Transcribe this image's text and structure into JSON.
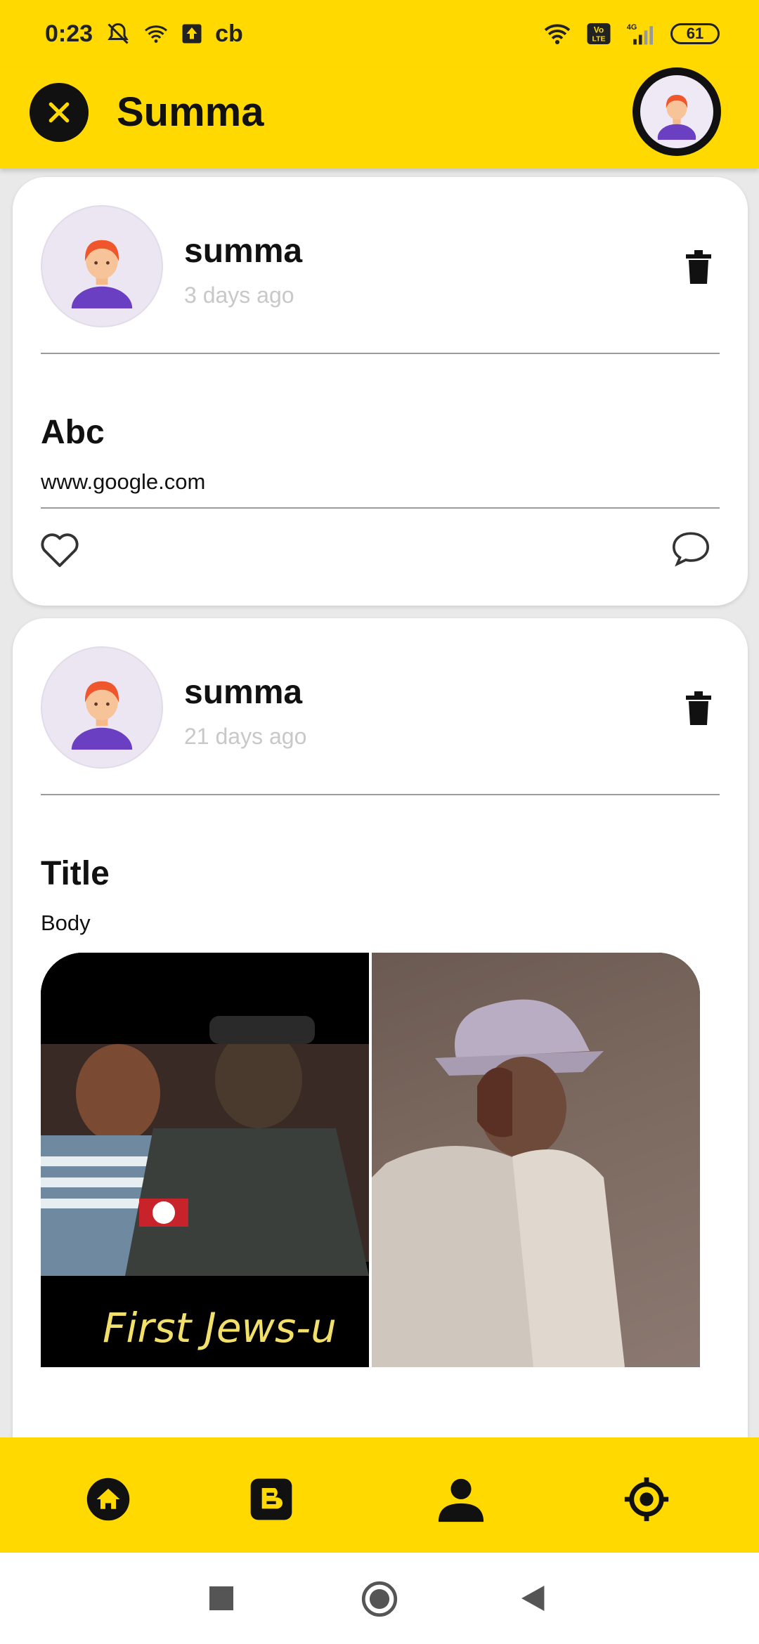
{
  "status_bar": {
    "time": "0:23",
    "left_icons": [
      "mute-icon",
      "wifi-icon",
      "upload-icon"
    ],
    "left_text": "cb",
    "network_badge": "Vo LTE",
    "network_type": "4G",
    "battery": "61"
  },
  "app_bar": {
    "title": "Summa",
    "close_icon": "close-icon",
    "profile_icon": "profile-avatar-icon"
  },
  "posts": [
    {
      "username": "summa",
      "time": "3 days ago",
      "title": "Abc",
      "body": "www.google.com",
      "actions": [
        "like-icon",
        "comment-icon"
      ]
    },
    {
      "username": "summa",
      "time": "21 days ago",
      "title": "Title",
      "body": "Body",
      "media_caption": "First Jews-u"
    }
  ],
  "bottom_nav": [
    {
      "icon": "home-icon"
    },
    {
      "icon": "blog-icon"
    },
    {
      "icon": "person-icon"
    },
    {
      "icon": "locate-icon"
    }
  ],
  "system_nav": [
    "recents-icon",
    "home-circle-icon",
    "back-icon"
  ],
  "colors": {
    "accent": "#ffd900",
    "card": "#ffffff",
    "time_text": "#c8c8c8"
  }
}
